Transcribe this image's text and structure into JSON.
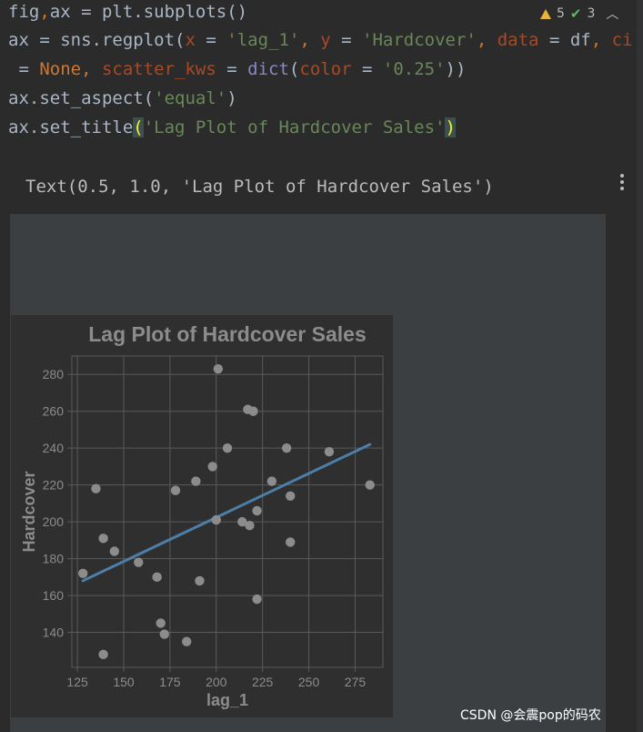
{
  "code_cell": {
    "line1": {
      "a": "fig",
      "b": ",",
      "c": "ax = plt.subplots()"
    },
    "line2": {
      "a": "ax = sns.regplot(",
      "b": "x",
      "c": " = ",
      "d": "'lag_1'",
      "e": ", ",
      "f": "y",
      "g": " = ",
      "h": "'Hardcover'",
      "i": ", ",
      "j": "data",
      "k": " = df",
      "l": ", ",
      "m": "ci"
    },
    "line3": {
      "a": " = ",
      "b": "None",
      "c": ", ",
      "d": "scatter_kws",
      "e": " = ",
      "f": "dict",
      "g": "(",
      "h": "color",
      "i": " = ",
      "j": "'0.25'",
      "k": "))"
    },
    "line4": {
      "a": "ax.set_aspect(",
      "b": "'equal'",
      "c": ")"
    },
    "line5": {
      "a": "ax.set_title",
      "b": "(",
      "c": "'Lag Plot of Hardcover Sales'",
      "d": ")"
    }
  },
  "inspection": {
    "warnings": "5",
    "checks": "3"
  },
  "output_text": "Text(0.5, 1.0, 'Lag Plot of Hardcover Sales')",
  "watermark": "CSDN @会震pop的码农",
  "colors": {
    "figure_bg": "#2f2f2f",
    "grid": "#5a5a5a",
    "points": "#8c8c8c",
    "line": "#4c7ea8",
    "text": "#8c8c8c"
  },
  "chart_data": {
    "type": "scatter",
    "title": "Lag Plot of Hardcover Sales",
    "xlabel": "lag_1",
    "ylabel": "Hardcover",
    "xlim": [
      122,
      290
    ],
    "ylim": [
      121,
      290
    ],
    "xticks": [
      125,
      150,
      175,
      200,
      225,
      250,
      275
    ],
    "yticks": [
      140,
      160,
      180,
      200,
      220,
      240,
      260,
      280
    ],
    "grid": true,
    "points": [
      {
        "x": 128,
        "y": 172
      },
      {
        "x": 135,
        "y": 218
      },
      {
        "x": 139,
        "y": 128
      },
      {
        "x": 139,
        "y": 191
      },
      {
        "x": 145,
        "y": 184
      },
      {
        "x": 158,
        "y": 178
      },
      {
        "x": 168,
        "y": 170
      },
      {
        "x": 170,
        "y": 145
      },
      {
        "x": 172,
        "y": 139
      },
      {
        "x": 178,
        "y": 217
      },
      {
        "x": 184,
        "y": 135
      },
      {
        "x": 189,
        "y": 222
      },
      {
        "x": 191,
        "y": 168
      },
      {
        "x": 198,
        "y": 230
      },
      {
        "x": 200,
        "y": 201
      },
      {
        "x": 201,
        "y": 283
      },
      {
        "x": 206,
        "y": 240
      },
      {
        "x": 214,
        "y": 200
      },
      {
        "x": 217,
        "y": 261
      },
      {
        "x": 218,
        "y": 198
      },
      {
        "x": 220,
        "y": 260
      },
      {
        "x": 222,
        "y": 206
      },
      {
        "x": 222,
        "y": 158
      },
      {
        "x": 230,
        "y": 222
      },
      {
        "x": 238,
        "y": 240
      },
      {
        "x": 240,
        "y": 214
      },
      {
        "x": 240,
        "y": 189
      },
      {
        "x": 261,
        "y": 238
      },
      {
        "x": 283,
        "y": 220
      }
    ],
    "regression": {
      "x": [
        128,
        283
      ],
      "y": [
        168,
        242
      ]
    }
  }
}
